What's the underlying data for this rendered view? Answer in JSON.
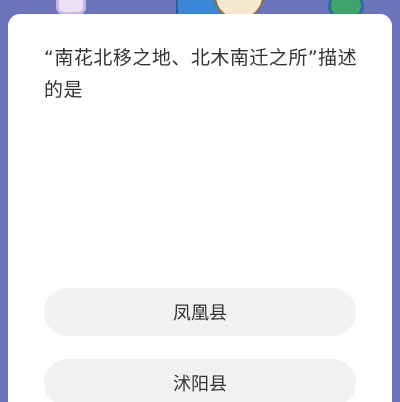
{
  "question": {
    "text": "“南花北移之地、北木南迁之所”描述的是"
  },
  "options": [
    {
      "label": "凤凰县"
    },
    {
      "label": "沭阳县"
    }
  ],
  "colors": {
    "background": "#6a73b8",
    "card": "#ffffff",
    "option_bg": "#f1f2f4",
    "text": "#333333"
  }
}
